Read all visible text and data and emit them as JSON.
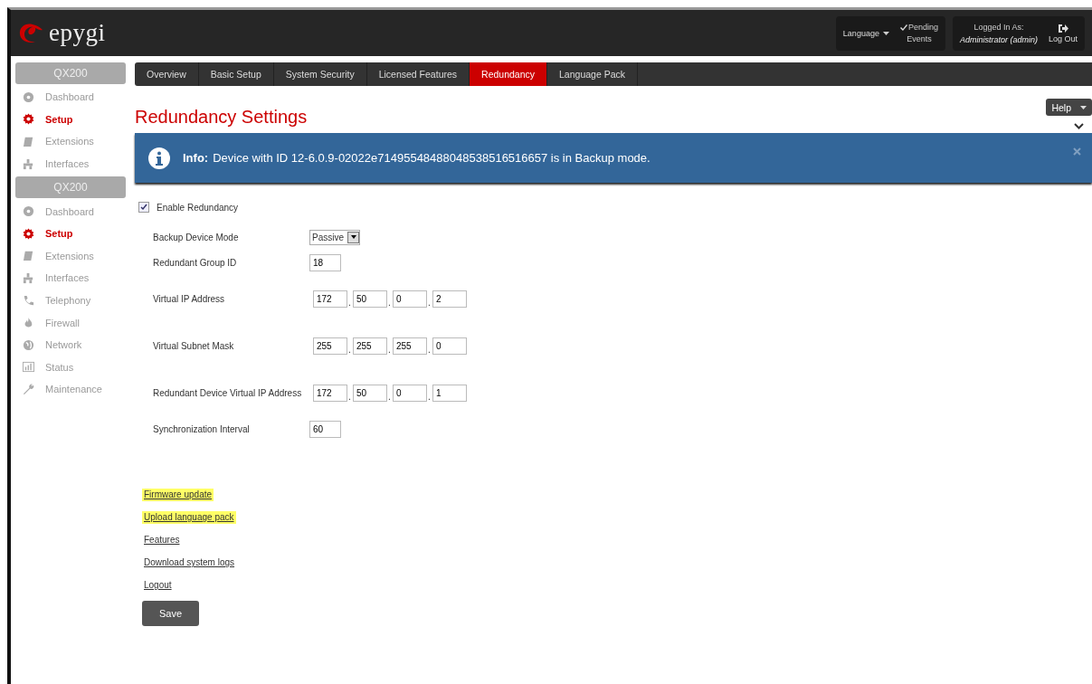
{
  "header": {
    "logo_text": "epygi",
    "language": "Language",
    "pending_line1": "Pending",
    "pending_line2": "Events",
    "logged_in_label": "Logged In As:",
    "user": "Administrator (admin)",
    "logout": "Log Out"
  },
  "sidebar": {
    "panels": [
      {
        "title": "QX200",
        "items": [
          {
            "label": "Dashboard",
            "selected": false
          },
          {
            "label": "Setup",
            "selected": true
          },
          {
            "label": "Extensions",
            "selected": false
          },
          {
            "label": "Interfaces",
            "selected": false
          }
        ]
      },
      {
        "title": "QX200",
        "items": [
          {
            "label": "Dashboard",
            "selected": false
          },
          {
            "label": "Setup",
            "selected": true
          },
          {
            "label": "Extensions",
            "selected": false
          },
          {
            "label": "Interfaces",
            "selected": false
          },
          {
            "label": "Telephony",
            "selected": false
          },
          {
            "label": "Firewall",
            "selected": false
          },
          {
            "label": "Network",
            "selected": false
          },
          {
            "label": "Status",
            "selected": false
          },
          {
            "label": "Maintenance",
            "selected": false
          }
        ]
      }
    ]
  },
  "tabs": [
    {
      "label": "Overview",
      "selected": false
    },
    {
      "label": "Basic Setup",
      "selected": false
    },
    {
      "label": "System Security",
      "selected": false
    },
    {
      "label": "Licensed Features",
      "selected": false
    },
    {
      "label": "Redundancy",
      "selected": true
    },
    {
      "label": "Language Pack",
      "selected": false
    }
  ],
  "page_title": "Redundancy Settings",
  "help_button": "Help",
  "info": {
    "label": "Info:",
    "message": "Device with ID 12-6.0.9-02022e71495548488048538516516657 is in Backup mode."
  },
  "enable_checkbox": {
    "label": "Enable Redundancy",
    "checked": true
  },
  "fields": [
    {
      "kind": "select",
      "label": "Backup Device Mode",
      "value": "Passive"
    },
    {
      "kind": "text",
      "label": "Redundant Group ID",
      "value": "18"
    },
    {
      "kind": "ip",
      "label": "Virtual IP Address",
      "separator": ".",
      "octets": [
        "172",
        "50",
        "0",
        "2"
      ]
    },
    {
      "kind": "ip",
      "label": "Virtual Subnet Mask",
      "separator": ".",
      "octets": [
        "255",
        "255",
        "255",
        "0"
      ]
    },
    {
      "kind": "ip",
      "label": "Redundant Device Virtual IP Address",
      "separator": ".",
      "octets": [
        "172",
        "50",
        "0",
        "1"
      ]
    },
    {
      "kind": "text",
      "label": "Synchronization Interval",
      "value": "60"
    }
  ],
  "links": [
    {
      "label": "Firmware update",
      "highlighted": true
    },
    {
      "label": "Upload language pack",
      "highlighted": true
    },
    {
      "label": "Features",
      "highlighted": false
    },
    {
      "label": "Download system logs",
      "highlighted": false
    },
    {
      "label": "Logout",
      "highlighted": false
    }
  ],
  "save_button": "Save"
}
